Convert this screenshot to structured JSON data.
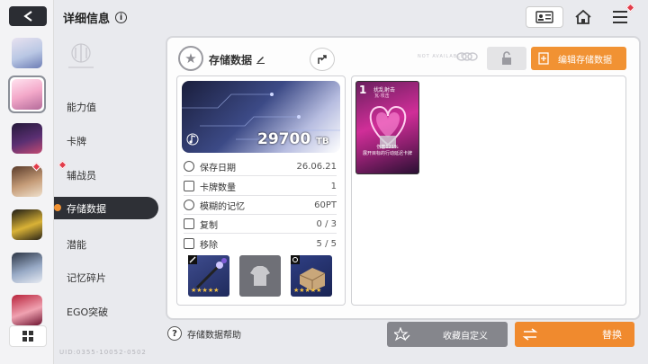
{
  "header": {
    "title": "详细信息",
    "info_glyph": "i"
  },
  "sidebar_menu": {
    "items": [
      "能力值",
      "卡牌",
      "辅战员",
      "存储数据",
      "潜能",
      "记忆碎片",
      "EGO突破"
    ],
    "active_index": 3
  },
  "data_panel": {
    "name": "存储数据",
    "capacity": "29700",
    "capacity_unit": "TB",
    "faint_label": "NOT AVAILABLE",
    "edit_label": "编辑存储数据",
    "stats": [
      {
        "icon": "clock-icon",
        "label": "保存日期",
        "value": "26.06.21"
      },
      {
        "icon": "card-icon",
        "label": "卡牌数量",
        "value": "1"
      },
      {
        "icon": "fuzzy-memory-icon",
        "label": "模糊的记忆",
        "value": "60PT"
      },
      {
        "icon": "copy-icon",
        "label": "复制",
        "value": "0 / 3"
      },
      {
        "icon": "remove-icon",
        "label": "移除",
        "value": "5 / 5"
      }
    ],
    "equipment": [
      {
        "type": "weapon",
        "stars": "★★★★★"
      },
      {
        "type": "armor-empty",
        "stars": ""
      },
      {
        "type": "accessory",
        "stars": "★★★★★"
      }
    ]
  },
  "card": {
    "cost": "1",
    "name": "扰乱射击",
    "subtitle": "瓦·攻击",
    "desc_line1": "伤害121%",
    "desc_line2": "展开目标的行动延迟卡牌"
  },
  "bottom": {
    "help_label": "存储数据帮助",
    "favorite_label": "收藏自定义",
    "replace_label": "替换",
    "footer_code": "UID:0355-10052-0502"
  },
  "colors": {
    "accent_orange": "#f19233",
    "dark": "#2e3036",
    "alert_red": "#e23c4a"
  }
}
